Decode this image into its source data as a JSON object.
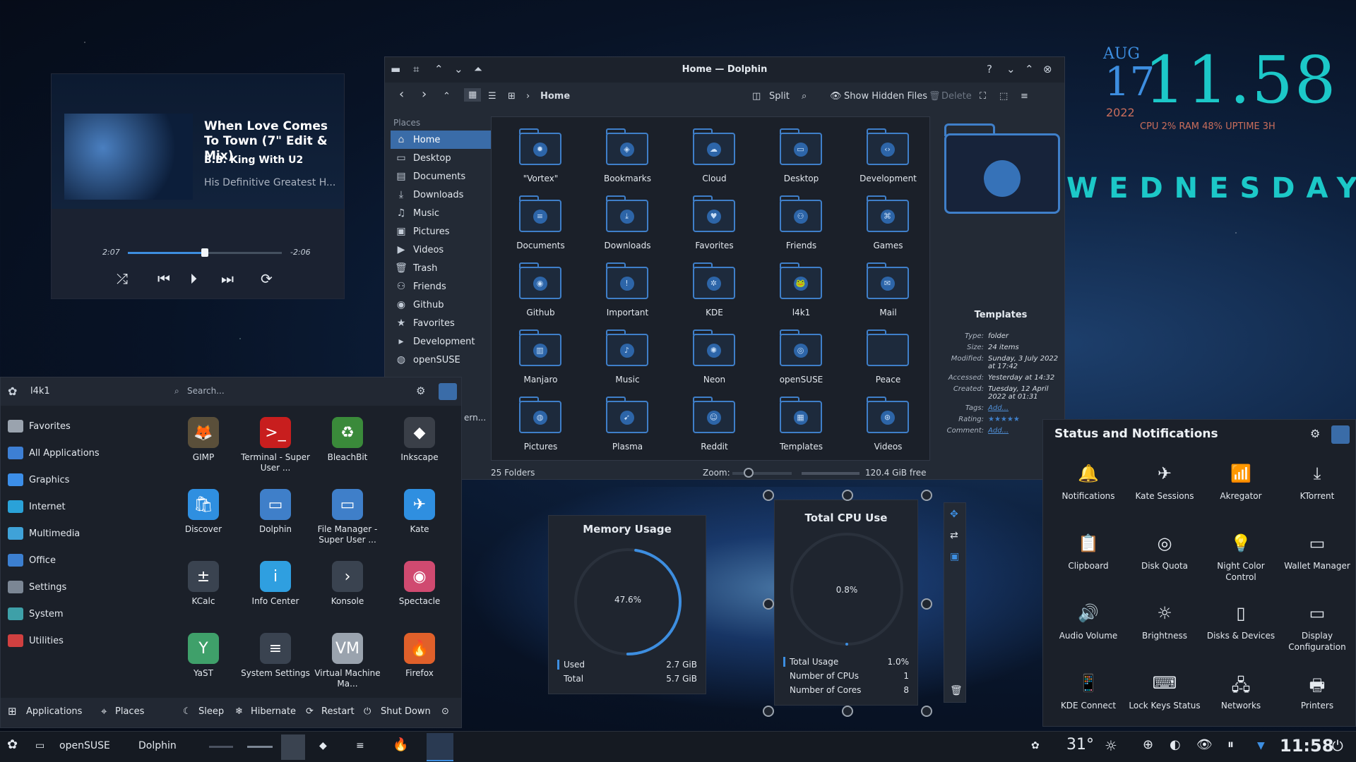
{
  "media": {
    "title": "When Love Comes To Town (7\" Edit & Mix)",
    "artist": "B.B. King With U2",
    "album": "His Definitive Greatest H...",
    "elapsed": "2:07",
    "remaining": "-2:06",
    "progress": 0.5
  },
  "dolphin": {
    "window_title": "Home — Dolphin",
    "breadcrumb": "Home",
    "toolbar": {
      "split": "Split",
      "hidden": "Show Hidden Files",
      "delete": "Delete"
    },
    "places_header": "Places",
    "places": [
      "Home",
      "Desktop",
      "Documents",
      "Downloads",
      "Music",
      "Pictures",
      "Videos",
      "Trash",
      "Friends",
      "Github",
      "Favorites",
      "Development",
      "openSUSE"
    ],
    "folders": [
      {
        "name": "\"Vortex\""
      },
      {
        "name": "Bookmarks"
      },
      {
        "name": "Cloud"
      },
      {
        "name": "Desktop"
      },
      {
        "name": "Development"
      },
      {
        "name": "Documents"
      },
      {
        "name": "Downloads"
      },
      {
        "name": "Favorites"
      },
      {
        "name": "Friends"
      },
      {
        "name": "Games"
      },
      {
        "name": "Github"
      },
      {
        "name": "Important"
      },
      {
        "name": "KDE"
      },
      {
        "name": "l4k1"
      },
      {
        "name": "Mail"
      },
      {
        "name": "Manjaro"
      },
      {
        "name": "Music"
      },
      {
        "name": "Neon"
      },
      {
        "name": "openSUSE"
      },
      {
        "name": "Peace"
      },
      {
        "name": "Pictures"
      },
      {
        "name": "Plasma"
      },
      {
        "name": "Reddit"
      },
      {
        "name": "Templates"
      },
      {
        "name": "Videos"
      }
    ],
    "info": {
      "name": "Templates",
      "type_k": "Type:",
      "type_v": "folder",
      "size_k": "Size:",
      "size_v": "24 items",
      "modified_k": "Modified:",
      "modified_v": "Sunday, 3 July 2022 at 17:42",
      "accessed_k": "Accessed:",
      "accessed_v": "Yesterday at 14:32",
      "created_k": "Created:",
      "created_v": "Tuesday, 12 April 2022 at 01:31",
      "tags_k": "Tags:",
      "tags_v": "Add...",
      "rating_k": "Rating:",
      "rating_v": "★★★★★",
      "comment_k": "Comment:",
      "comment_v": "Add..."
    },
    "status_folders": "25 Folders",
    "zoom_label": "Zoom:",
    "free": "120.4 GiB free"
  },
  "launcher": {
    "user": "l4k1",
    "search_placeholder": "Search...",
    "partial_label": "ern...",
    "categories": [
      {
        "label": "Favorites",
        "color": "#9aa3ae"
      },
      {
        "label": "All Applications",
        "color": "#3d7fd4"
      },
      {
        "label": "Graphics",
        "color": "#3c8ee8"
      },
      {
        "label": "Internet",
        "color": "#2aa2d8"
      },
      {
        "label": "Multimedia",
        "color": "#3fa2d8"
      },
      {
        "label": "Office",
        "color": "#3c7fd0"
      },
      {
        "label": "Settings",
        "color": "#7b8694"
      },
      {
        "label": "System",
        "color": "#3ea0a8"
      },
      {
        "label": "Utilities",
        "color": "#d04040"
      }
    ],
    "apps": [
      {
        "label": "GIMP",
        "color": "#5a4f3a",
        "glyph": "🦊"
      },
      {
        "label": "Terminal - Super User ...",
        "color": "#c81e1e",
        "glyph": ">_"
      },
      {
        "label": "BleachBit",
        "color": "#3a8a3a",
        "glyph": "♻"
      },
      {
        "label": "Inkscape",
        "color": "#3a3f48",
        "glyph": "◆"
      },
      {
        "label": "Discover",
        "color": "#2f8fe0",
        "glyph": "🛍"
      },
      {
        "label": "Dolphin",
        "color": "#3f7fc9",
        "glyph": "▭"
      },
      {
        "label": "File Manager - Super User ...",
        "color": "#3f7fc9",
        "glyph": "▭"
      },
      {
        "label": "Kate",
        "color": "#2f8fe0",
        "glyph": "✈"
      },
      {
        "label": "KCalc",
        "color": "#3a4350",
        "glyph": "±"
      },
      {
        "label": "Info Center",
        "color": "#2f9fe0",
        "glyph": "i"
      },
      {
        "label": "Konsole",
        "color": "#3a4350",
        "glyph": "›"
      },
      {
        "label": "Spectacle",
        "color": "#d04a70",
        "glyph": "◉"
      },
      {
        "label": "YaST",
        "color": "#3fa06a",
        "glyph": "Y"
      },
      {
        "label": "System Settings",
        "color": "#3a4350",
        "glyph": "≡"
      },
      {
        "label": "Virtual Machine Ma...",
        "color": "#9aa3ae",
        "glyph": "VM"
      },
      {
        "label": "Firefox",
        "color": "#e0602a",
        "glyph": "🔥"
      }
    ],
    "footer": {
      "applications": "Applications",
      "places": "Places",
      "sleep": "Sleep",
      "hibernate": "Hibernate",
      "restart": "Restart",
      "shutdown": "Shut Down"
    }
  },
  "memory": {
    "title": "Memory Usage",
    "percent": "47.6%",
    "fraction": 0.476,
    "used_k": "Used",
    "used_v": "2.7 GiB",
    "total_k": "Total",
    "total_v": "5.7 GiB"
  },
  "cpu": {
    "title": "Total CPU Use",
    "percent": "0.8%",
    "total_usage_k": "Total Usage",
    "total_usage_v": "1.0%",
    "cpus_k": "Number of CPUs",
    "cpus_v": "1",
    "cores_k": "Number of Cores",
    "cores_v": "8"
  },
  "clock": {
    "month": "AUG",
    "day": "17",
    "year": "2022",
    "time": "11.58",
    "stats": "CPU 2% RAM 48% UPTIME 3H",
    "weekday": "WEDNESDAY"
  },
  "tray": {
    "title": "Status and Notifications",
    "items": [
      {
        "label": "Notifications",
        "glyph": "🔔"
      },
      {
        "label": "Kate Sessions",
        "glyph": "✈"
      },
      {
        "label": "Akregator",
        "glyph": "📶"
      },
      {
        "label": "KTorrent",
        "glyph": "⤓"
      },
      {
        "label": "Clipboard",
        "glyph": "📋"
      },
      {
        "label": "Disk Quota",
        "glyph": "◎"
      },
      {
        "label": "Night Color Control",
        "glyph": "💡"
      },
      {
        "label": "Wallet Manager",
        "glyph": "▭"
      },
      {
        "label": "Audio Volume",
        "glyph": "🔊"
      },
      {
        "label": "Brightness",
        "glyph": "☼"
      },
      {
        "label": "Disks & Devices",
        "glyph": "▯"
      },
      {
        "label": "Display Configuration",
        "glyph": "▭"
      },
      {
        "label": "KDE Connect",
        "glyph": "📱"
      },
      {
        "label": "Lock Keys Status",
        "glyph": "⌨"
      },
      {
        "label": "Networks",
        "glyph": "🖧"
      },
      {
        "label": "Printers",
        "glyph": "🖶"
      }
    ]
  },
  "taskbar": {
    "activity": "openSUSE",
    "window": "Dolphin",
    "temperature": "31°",
    "time": "11:58"
  }
}
